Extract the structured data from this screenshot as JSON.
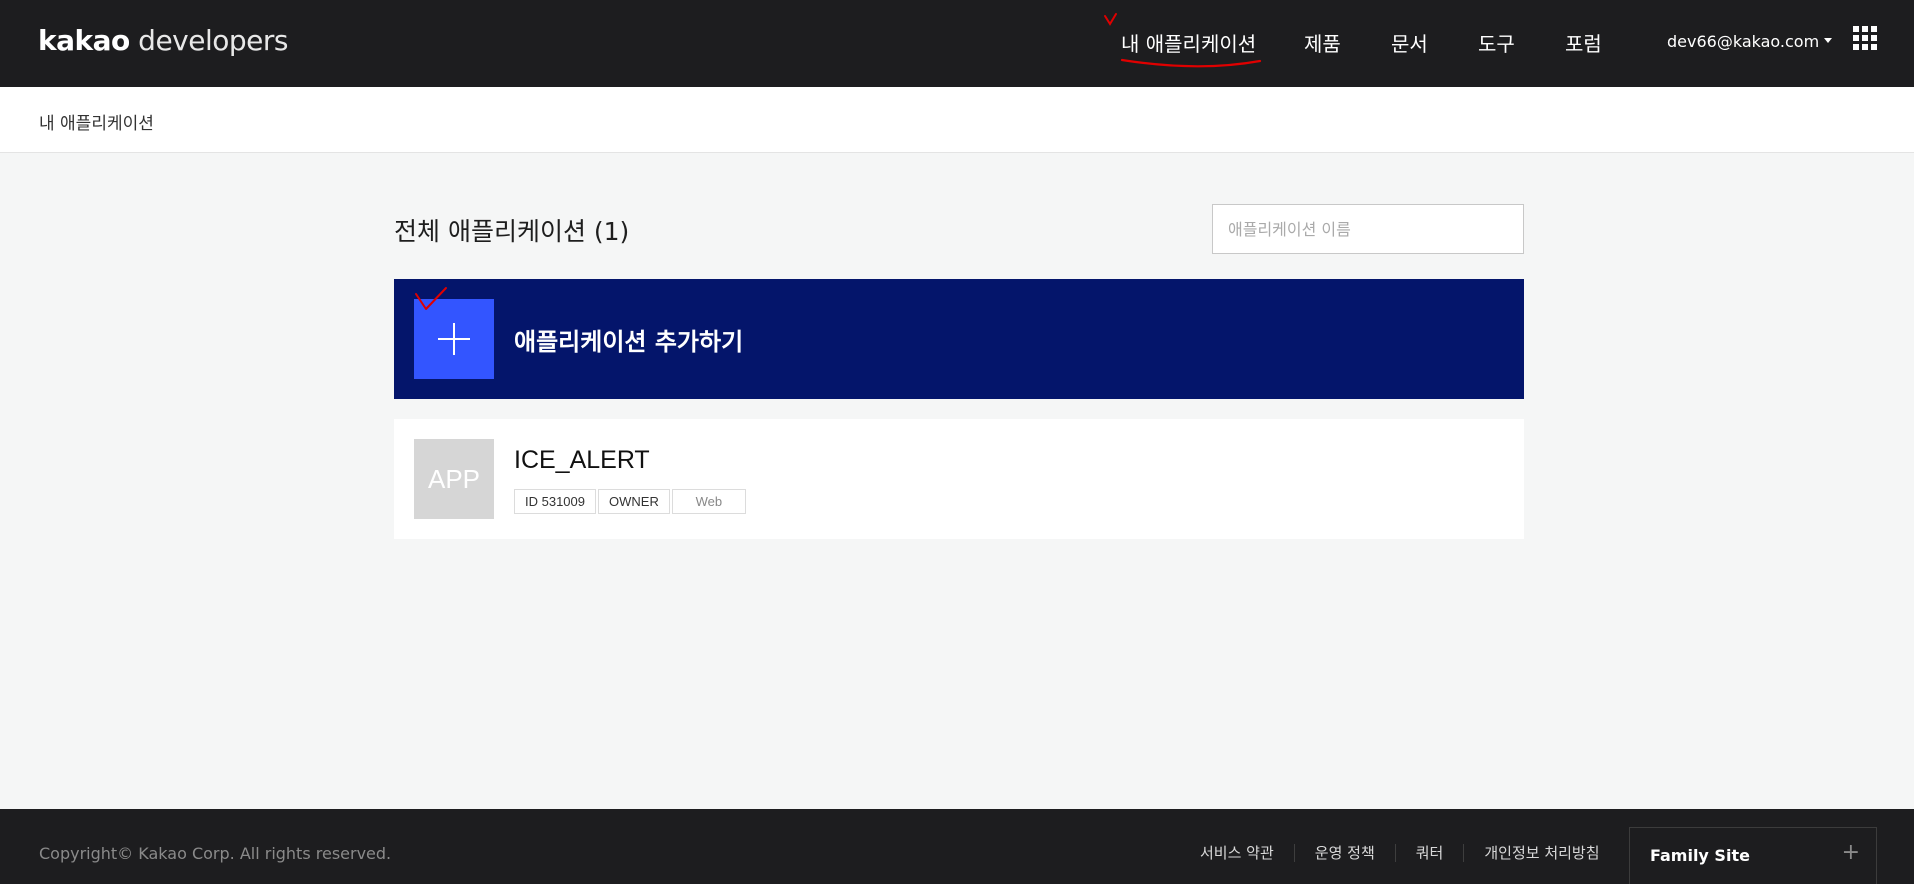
{
  "header": {
    "logo_bold": "kakao",
    "logo_light": " developers",
    "nav": [
      {
        "label": "내 애플리케이션"
      },
      {
        "label": "제품"
      },
      {
        "label": "문서"
      },
      {
        "label": "도구"
      },
      {
        "label": "포럼"
      }
    ],
    "user_email": "dev66@kakao.com",
    "apps_icon": "grid-icon"
  },
  "breadcrumb": {
    "label": "내 애플리케이션"
  },
  "main": {
    "title": "전체 애플리케이션 (1)",
    "search_placeholder": "애플리케이션 이름",
    "add_app_label": "애플리케이션 추가하기",
    "apps": [
      {
        "thumb": "APP",
        "name": "ICE_ALERT",
        "tags": [
          "ID 531009",
          "OWNER",
          "Web"
        ]
      }
    ]
  },
  "footer": {
    "copyright": "Copyright© Kakao Corp. All rights reserved.",
    "links": [
      "서비스 약관",
      "운영 정책",
      "쿼터",
      "개인정보 처리방침"
    ],
    "family_site": "Family Site",
    "family_site_icon": "+"
  },
  "colors": {
    "header_bg": "#1d1d1f",
    "add_banner_bg": "#04156b",
    "plus_box": "#3355ff",
    "annotation": "#e00000"
  }
}
